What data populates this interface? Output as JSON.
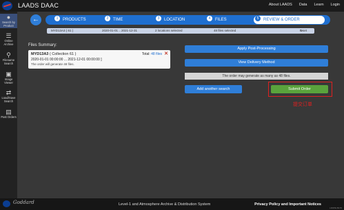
{
  "header": {
    "title": "LAADS DAAC",
    "nav": [
      "About LAADS",
      "Data",
      "Learn",
      "Login"
    ]
  },
  "sidebar": {
    "items": [
      {
        "label": "Search by Product",
        "icon": "nasa-mini-icon"
      },
      {
        "label": "Online Archive",
        "icon": "list-icon"
      },
      {
        "label": "Filename Search",
        "icon": "search-icon"
      },
      {
        "label": "Image Viewer",
        "icon": "image-icon"
      },
      {
        "label": "Load/Save Search",
        "icon": "load-save-icon"
      },
      {
        "label": "Past Orders",
        "icon": "folder-icon"
      }
    ]
  },
  "stepper": {
    "steps": [
      {
        "num": "1",
        "label": "PRODUCTS"
      },
      {
        "num": "2",
        "label": "TIME"
      },
      {
        "num": "3",
        "label": "LOCATION"
      },
      {
        "num": "4",
        "label": "FILES"
      },
      {
        "num": "5",
        "label": "REVIEW & ORDER"
      }
    ]
  },
  "summary": {
    "product": "MYD13A3 ( 61 )",
    "dates": "2020-01-01 .. 2021-12-31",
    "location": "2 locations selected",
    "files": "48 files selected",
    "reset": "reset"
  },
  "files": {
    "title": "Files Summary:",
    "card": {
      "product": "MYD13A3",
      "collection": "( Collection 61 )",
      "dates": "2020-01-01 00:00:00 ... 2021-12-01 00:00:00 ]",
      "note": "The order will generate 48 files.",
      "total_label": "Total:",
      "total_link": "48 files"
    }
  },
  "actions": {
    "apply": "Apply Post-Processing",
    "delivery": "View Delivery Method",
    "notice": "The order may generate as many as 48 files.",
    "add_search": "Add another search",
    "submit": "Submit Order",
    "annotation": "提交订单"
  },
  "footer": {
    "signature": "Goddard",
    "center": "Level-1 and Atmosphere Archive & Distribution System",
    "right": "Privacy Policy and Important Notices",
    "code": "LDOPE BLT6"
  },
  "colors": {
    "accent": "#1f6fd0",
    "submit": "#5aa33c",
    "highlight": "#e02020"
  }
}
